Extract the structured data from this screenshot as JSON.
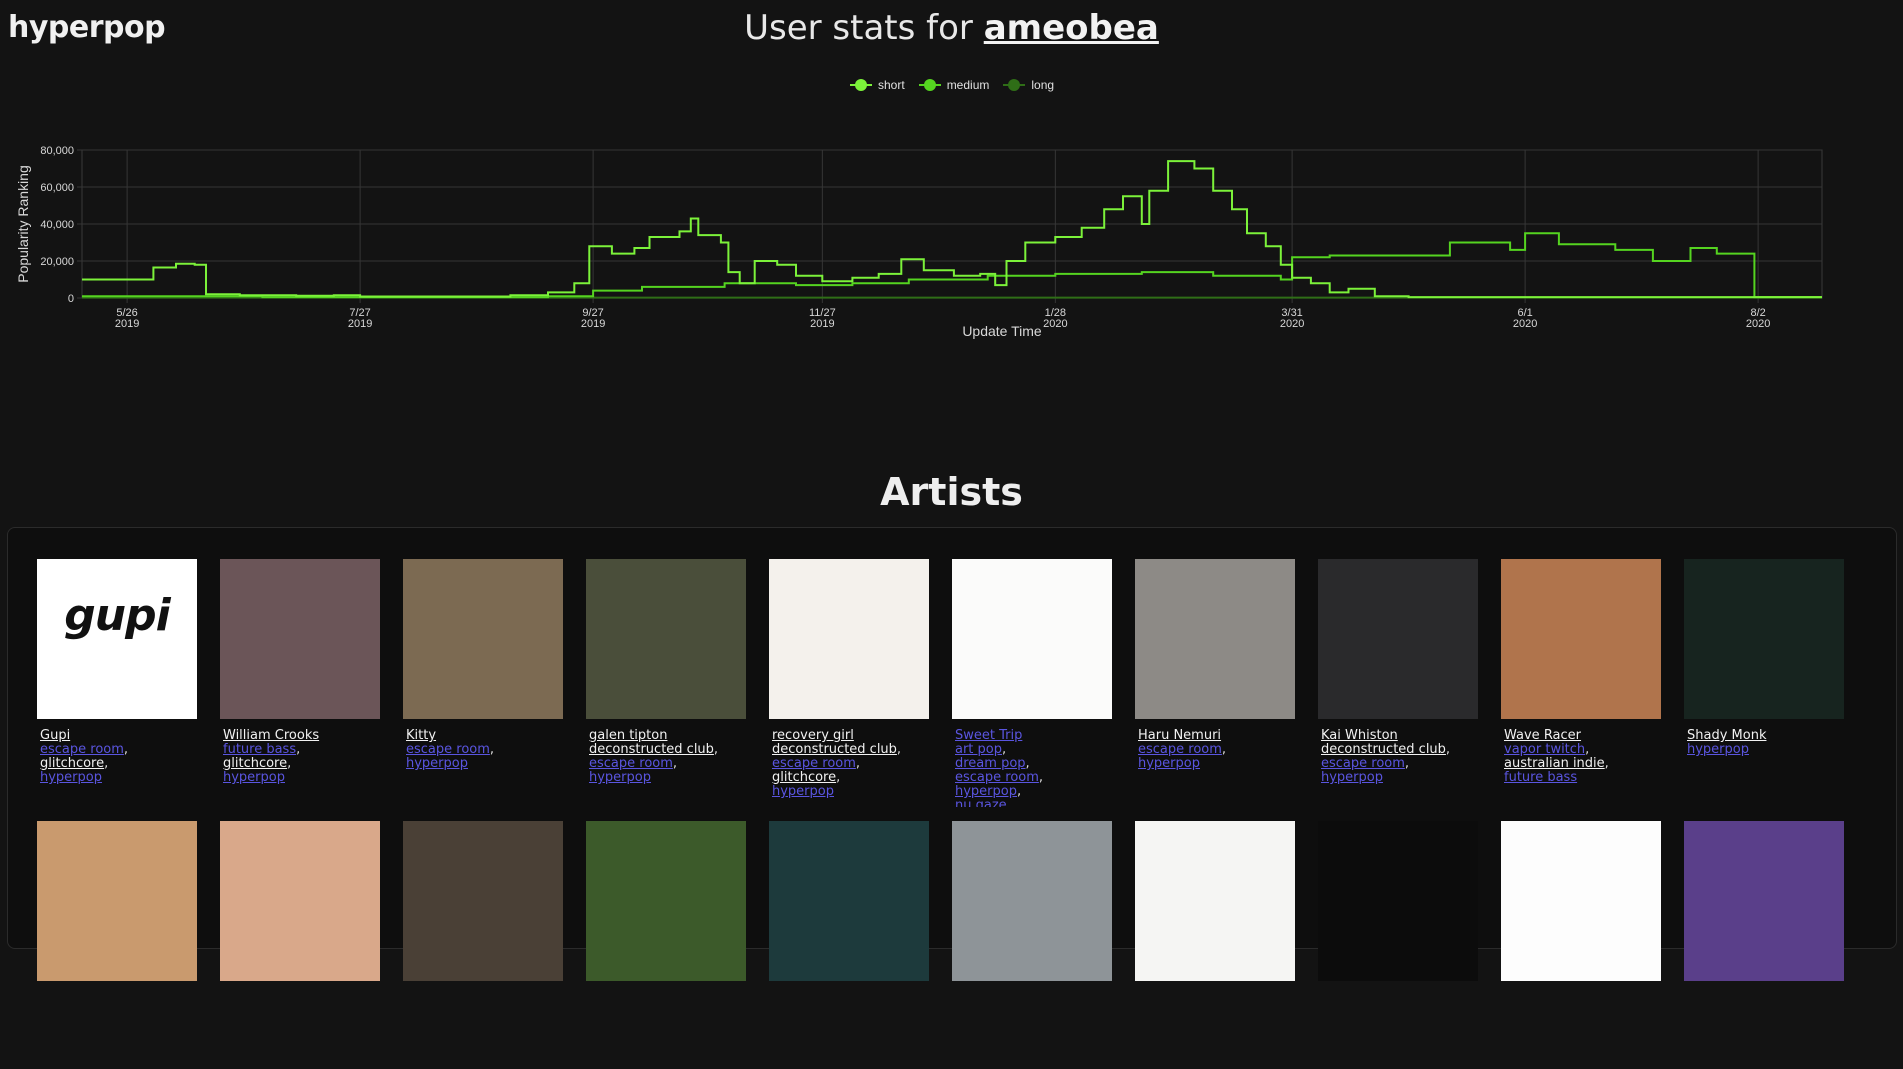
{
  "header": {
    "brand": "hyperpop",
    "title_prefix": "User stats for",
    "username": "ameobea"
  },
  "legend": [
    {
      "label": "short",
      "color": "#7cf23a"
    },
    {
      "label": "medium",
      "color": "#55d420"
    },
    {
      "label": "long",
      "color": "#2f6e17"
    }
  ],
  "chart_data": {
    "type": "line",
    "title": "",
    "xlabel": "Update Time",
    "ylabel": "Popularity Ranking",
    "ylim": [
      0,
      80000
    ],
    "yticks": [
      "0",
      "20,000",
      "40,000",
      "60,000",
      "80,000"
    ],
    "xticks": [
      {
        "date": "2019-05-26",
        "top": "5/26",
        "bottom": "2019"
      },
      {
        "date": "2019-07-27",
        "top": "7/27",
        "bottom": "2019"
      },
      {
        "date": "2019-09-27",
        "top": "9/27",
        "bottom": "2019"
      },
      {
        "date": "2019-11-27",
        "top": "11/27",
        "bottom": "2019"
      },
      {
        "date": "2020-01-28",
        "top": "1/28",
        "bottom": "2020"
      },
      {
        "date": "2020-03-31",
        "top": "3/31",
        "bottom": "2020"
      },
      {
        "date": "2020-06-01",
        "top": "6/1",
        "bottom": "2020"
      },
      {
        "date": "2020-08-02",
        "top": "8/2",
        "bottom": "2020"
      }
    ],
    "xlim": [
      "2019-05-14",
      "2020-08-19"
    ],
    "grid": true,
    "legend_position": "top-center",
    "series": [
      {
        "name": "short",
        "color": "#7cf23a",
        "points": [
          [
            "2019-05-14",
            10000
          ],
          [
            "2019-06-02",
            16500
          ],
          [
            "2019-06-08",
            18500
          ],
          [
            "2019-06-13",
            18000
          ],
          [
            "2019-06-16",
            2000
          ],
          [
            "2019-06-25",
            1500
          ],
          [
            "2019-07-10",
            1200
          ],
          [
            "2019-07-20",
            1500
          ],
          [
            "2019-07-27",
            800
          ],
          [
            "2019-08-20",
            800
          ],
          [
            "2019-09-05",
            1500
          ],
          [
            "2019-09-15",
            3000
          ],
          [
            "2019-09-22",
            8000
          ],
          [
            "2019-09-26",
            28000
          ],
          [
            "2019-10-02",
            24000
          ],
          [
            "2019-10-08",
            27000
          ],
          [
            "2019-10-12",
            33000
          ],
          [
            "2019-10-20",
            36000
          ],
          [
            "2019-10-23",
            43000
          ],
          [
            "2019-10-25",
            34000
          ],
          [
            "2019-10-31",
            30000
          ],
          [
            "2019-11-02",
            14000
          ],
          [
            "2019-11-05",
            8000
          ],
          [
            "2019-11-09",
            20000
          ],
          [
            "2019-11-15",
            18000
          ],
          [
            "2019-11-20",
            12000
          ],
          [
            "2019-11-27",
            9000
          ],
          [
            "2019-12-05",
            11000
          ],
          [
            "2019-12-12",
            13000
          ],
          [
            "2019-12-18",
            21000
          ],
          [
            "2019-12-24",
            15000
          ],
          [
            "2020-01-01",
            12000
          ],
          [
            "2020-01-08",
            13000
          ],
          [
            "2020-01-12",
            7000
          ],
          [
            "2020-01-15",
            20000
          ],
          [
            "2020-01-20",
            30000
          ],
          [
            "2020-01-28",
            33000
          ],
          [
            "2020-02-04",
            38000
          ],
          [
            "2020-02-10",
            48000
          ],
          [
            "2020-02-15",
            55000
          ],
          [
            "2020-02-20",
            40000
          ],
          [
            "2020-02-22",
            58000
          ],
          [
            "2020-02-27",
            74000
          ],
          [
            "2020-03-05",
            70000
          ],
          [
            "2020-03-10",
            58000
          ],
          [
            "2020-03-15",
            48000
          ],
          [
            "2020-03-19",
            35000
          ],
          [
            "2020-03-24",
            28000
          ],
          [
            "2020-03-28",
            18000
          ],
          [
            "2020-03-31",
            11000
          ],
          [
            "2020-04-05",
            8000
          ],
          [
            "2020-04-10",
            3000
          ],
          [
            "2020-04-15",
            5000
          ],
          [
            "2020-04-22",
            1000
          ],
          [
            "2020-05-01",
            500
          ],
          [
            "2020-08-19",
            500
          ]
        ]
      },
      {
        "name": "medium",
        "color": "#55d420",
        "points": [
          [
            "2019-05-14",
            1000
          ],
          [
            "2019-07-01",
            500
          ],
          [
            "2019-09-15",
            1000
          ],
          [
            "2019-09-27",
            4000
          ],
          [
            "2019-10-10",
            6000
          ],
          [
            "2019-11-01",
            8000
          ],
          [
            "2019-11-20",
            7000
          ],
          [
            "2019-12-05",
            8000
          ],
          [
            "2019-12-20",
            10000
          ],
          [
            "2020-01-10",
            12000
          ],
          [
            "2020-01-28",
            13000
          ],
          [
            "2020-02-20",
            14000
          ],
          [
            "2020-03-10",
            12000
          ],
          [
            "2020-03-28",
            10000
          ],
          [
            "2020-03-31",
            22000
          ],
          [
            "2020-04-10",
            23000
          ],
          [
            "2020-05-05",
            23000
          ],
          [
            "2020-05-12",
            30000
          ],
          [
            "2020-05-28",
            26000
          ],
          [
            "2020-06-01",
            35000
          ],
          [
            "2020-06-10",
            29000
          ],
          [
            "2020-06-25",
            26000
          ],
          [
            "2020-07-05",
            20000
          ],
          [
            "2020-07-15",
            27000
          ],
          [
            "2020-07-22",
            24000
          ],
          [
            "2020-07-31",
            24000
          ],
          [
            "2020-08-01",
            500
          ],
          [
            "2020-08-19",
            500
          ]
        ]
      },
      {
        "name": "long",
        "color": "#2f6e17",
        "points": [
          [
            "2019-05-14",
            200
          ],
          [
            "2020-08-19",
            200
          ]
        ]
      }
    ]
  },
  "artists_section": {
    "title": "Artists",
    "artists": [
      {
        "name": "Gupi",
        "logo_text": "gupi",
        "image_bg": "#ffffff",
        "genres": [
          {
            "label": "escape room",
            "style": "blue"
          },
          {
            "label": "glitchcore",
            "style": "white"
          },
          {
            "label": "hyperpop",
            "style": "blue"
          }
        ]
      },
      {
        "name": "William Crooks",
        "image_bg": "#6b5558",
        "genres": [
          {
            "label": "future bass",
            "style": "blue"
          },
          {
            "label": "glitchcore",
            "style": "white"
          },
          {
            "label": "hyperpop",
            "style": "blue"
          }
        ]
      },
      {
        "name": "Kitty",
        "image_bg": "#7c6a52",
        "genres": [
          {
            "label": "escape room",
            "style": "blue"
          },
          {
            "label": "hyperpop",
            "style": "blue"
          }
        ]
      },
      {
        "name": "galen tipton",
        "image_bg": "#4a4e3a",
        "genres": [
          {
            "label": "deconstructed club",
            "style": "white"
          },
          {
            "label": "escape room",
            "style": "blue"
          },
          {
            "label": "hyperpop",
            "style": "blue"
          }
        ]
      },
      {
        "name": "recovery girl",
        "image_bg": "#f4f1ec",
        "genres": [
          {
            "label": "deconstructed club",
            "style": "white"
          },
          {
            "label": "escape room",
            "style": "blue"
          },
          {
            "label": "glitchcore",
            "style": "white"
          },
          {
            "label": "hyperpop",
            "style": "blue"
          }
        ]
      },
      {
        "name": "Sweet Trip",
        "name_style": "blue",
        "image_bg": "#fbfbfa",
        "genres": [
          {
            "label": "art pop",
            "style": "blue"
          },
          {
            "label": "dream pop",
            "style": "blue"
          },
          {
            "label": "escape room",
            "style": "blue"
          },
          {
            "label": "hyperpop",
            "style": "blue"
          },
          {
            "label": "nu gaze",
            "style": "blue"
          }
        ]
      },
      {
        "name": "Haru Nemuri",
        "image_bg": "#8d8a86",
        "genres": [
          {
            "label": "escape room",
            "style": "blue"
          },
          {
            "label": "hyperpop",
            "style": "blue"
          }
        ]
      },
      {
        "name": "Kai Whiston",
        "image_bg": "#2a2a2c",
        "genres": [
          {
            "label": "deconstructed club",
            "style": "white"
          },
          {
            "label": "escape room",
            "style": "blue"
          },
          {
            "label": "hyperpop",
            "style": "blue"
          }
        ]
      },
      {
        "name": "Wave Racer",
        "image_bg": "#b0744c",
        "genres": [
          {
            "label": "vapor twitch",
            "style": "blue"
          },
          {
            "label": "australian indie",
            "style": "white"
          },
          {
            "label": "future bass",
            "style": "blue"
          }
        ]
      },
      {
        "name": "Shady Monk",
        "image_bg": "#17241f",
        "genres": [
          {
            "label": "hyperpop",
            "style": "blue"
          }
        ]
      },
      {
        "name": "",
        "image_bg": "#c99a6e",
        "genres": []
      },
      {
        "name": "",
        "image_bg": "#d9a88a",
        "genres": []
      },
      {
        "name": "",
        "image_bg": "#4a4036",
        "genres": []
      },
      {
        "name": "",
        "image_bg": "#3c5a2a",
        "genres": []
      },
      {
        "name": "",
        "image_bg": "#1d3a3c",
        "genres": []
      },
      {
        "name": "",
        "image_bg": "#8e9498",
        "genres": []
      },
      {
        "name": "",
        "image_bg": "#f5f5f3",
        "genres": []
      },
      {
        "name": "",
        "image_bg": "#0c0c0c",
        "genres": []
      },
      {
        "name": "",
        "image_bg": "#fdfdfd",
        "genres": []
      },
      {
        "name": "",
        "image_bg": "#5a3f8a",
        "genres": []
      }
    ]
  }
}
